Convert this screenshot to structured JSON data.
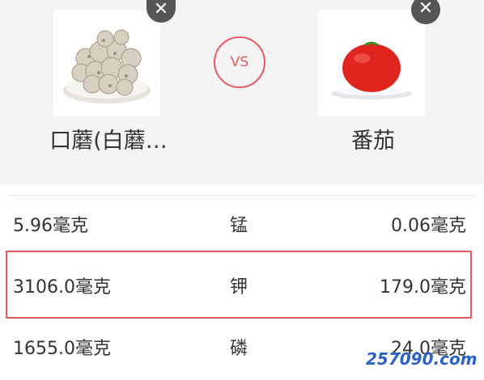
{
  "compare": {
    "left": {
      "name": "口蘑(白蘑…",
      "remove_icon": "close-icon"
    },
    "vs_label": "VS",
    "right": {
      "name": "番茄",
      "remove_icon": "close-icon"
    }
  },
  "rows": [
    {
      "left": "5.96毫克",
      "nutrient": "锰",
      "right": "0.06毫克"
    },
    {
      "left": "3106.0毫克",
      "nutrient": "钾",
      "right": "179.0毫克"
    },
    {
      "left": "1655.0毫克",
      "nutrient": "磷",
      "right": "24.0毫克"
    }
  ],
  "watermark": "257090.com",
  "colors": {
    "accent": "#e9585c",
    "header_bg": "#f4f4f4"
  }
}
